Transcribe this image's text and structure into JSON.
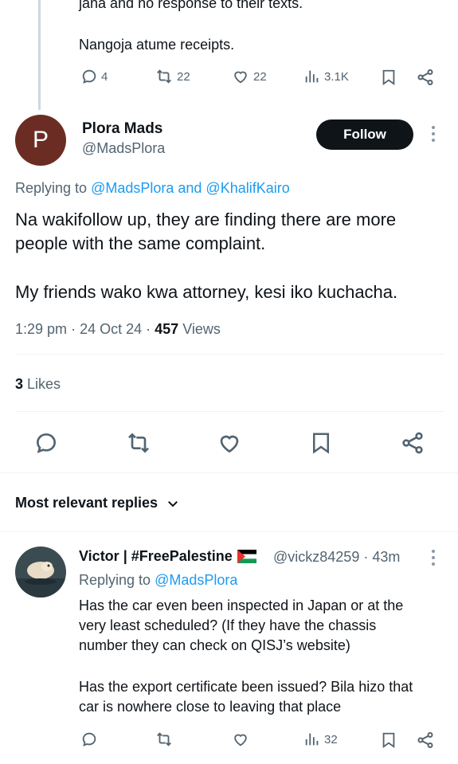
{
  "top_tweet": {
    "partial_line": "jana and no response to their texts.",
    "line2": "Nangoja atume receipts.",
    "actions": {
      "replies": "4",
      "reposts": "22",
      "likes": "22",
      "views": "3.1K"
    }
  },
  "main_tweet": {
    "avatar_letter": "P",
    "author_name": "Plora Mads",
    "author_handle": "@MadsPlora",
    "follow_label": "Follow",
    "replying_prefix": "Replying to",
    "replying_users": "@MadsPlora and @KhalifKairo",
    "text_line1": "Na wakifollow up, they are finding there are more",
    "text_line2": "people with the same complaint.",
    "text_line3": "My friends wako kwa attorney, kesi iko kuchacha.",
    "time": "1:29 pm",
    "date": "24 Oct 24",
    "views_count": "457",
    "views_label": "Views",
    "likes_count": "3",
    "likes_label": "Likes"
  },
  "sort": {
    "label": "Most relevant replies"
  },
  "reply": {
    "author_name": "Victor | #FreePalestine",
    "flag": "palestine-flag",
    "author_handle": "@vickz84259 · 43m",
    "replying_prefix": "Replying to",
    "replying_users": "@MadsPlora",
    "para1_line1": "Has the car even been inspected in Japan or at the",
    "para1_line2": "very least scheduled? (If they have the chassis",
    "para1_line3": "number they can check on QISJ’s website)",
    "para2_line1": "Has the export certificate been issued? Bila hizo that",
    "para2_line2": "car is nowhere close to leaving that place",
    "actions": {
      "views": "32"
    }
  },
  "colors": {
    "link": "#1d9bf0",
    "muted": "#536471",
    "follow_bg": "#0f1419",
    "avatar_bg": "#6b2d23"
  }
}
